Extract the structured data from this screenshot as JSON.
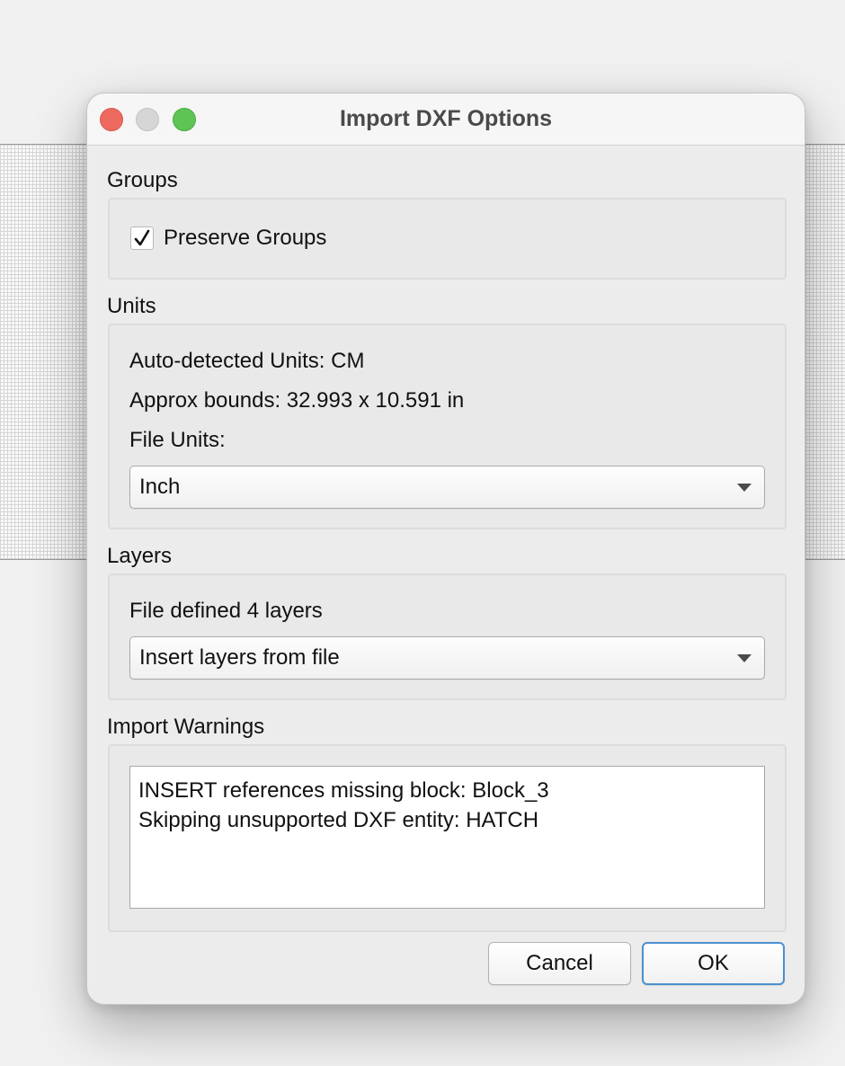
{
  "window": {
    "title": "Import DXF Options"
  },
  "groups": {
    "label": "Groups",
    "preserve_groups": {
      "label": "Preserve Groups",
      "checked": true
    }
  },
  "units": {
    "label": "Units",
    "auto_detected": "Auto-detected Units: CM",
    "approx_bounds": "Approx bounds: 32.993 x 10.591 in",
    "file_units_label": "File Units:",
    "file_units_value": "Inch"
  },
  "layers": {
    "label": "Layers",
    "info": "File defined 4 layers",
    "mode_value": "Insert layers from file"
  },
  "warnings": {
    "label": "Import Warnings",
    "lines": [
      "INSERT references missing block: Block_3",
      "Skipping unsupported DXF entity: HATCH"
    ]
  },
  "buttons": {
    "cancel": "Cancel",
    "ok": "OK"
  },
  "colors": {
    "close": "#ee6a5e",
    "minimize": "#d6d6d6",
    "maximize": "#5ec453",
    "default_button_border": "#4a90d0"
  },
  "icons": {
    "checkmark": "checkmark-icon",
    "dropdown": "chevron-down-icon"
  }
}
